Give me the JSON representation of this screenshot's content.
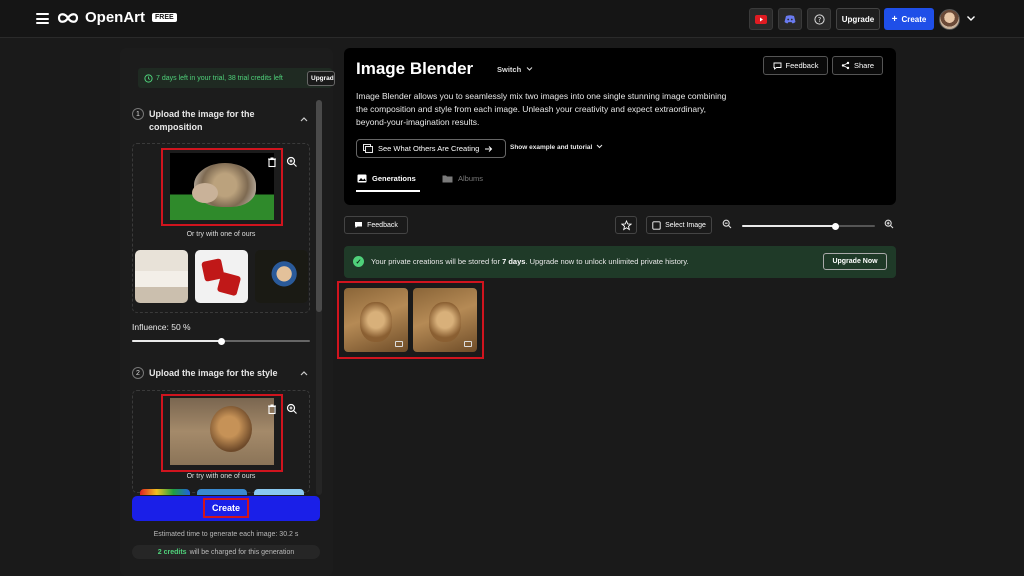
{
  "topbar": {
    "logo_text": "OpenArt",
    "badge": "FREE",
    "upgrade_label": "Upgrade",
    "create_label": "Create",
    "create_icon": "+"
  },
  "left": {
    "trial_text": "7 days left in your trial, 38 trial credits left",
    "trial_upgrade": "Upgrade",
    "step1": {
      "num": "1",
      "title_line1": "Upload the image for the",
      "title_line2": "composition"
    },
    "or_try": "Or try with one of ours",
    "influence": "Influence: 50 %",
    "influence_value": 50,
    "step2": {
      "num": "2",
      "title": "Upload the image for the style"
    },
    "or_try2": "Or try with one of ours",
    "create_label": "Create",
    "estimate": "Estimated time to generate each image: 30.2 s",
    "credits_bold": "2 credits",
    "credits_rest": "will be charged for this generation"
  },
  "hero": {
    "title": "Image Blender",
    "switch": "Switch",
    "feedback": "Feedback",
    "share": "Share",
    "description": "Image Blender allows you to seamlessly mix two images into one single stunning image combining the composition and style from each image. Unleash your creativity and expect extraordinary, beyond-your-imagination results.",
    "see_others": "See What Others Are Creating",
    "show_example": "Show example and tutorial",
    "tab_generations": "Generations",
    "tab_albums": "Albums"
  },
  "toolbar": {
    "feedback": "Feedback",
    "select_image": "Select Image",
    "zoom_level": 0.7
  },
  "notice": {
    "text_before": "Your private creations will be stored for",
    "days": "7 days",
    "text_after": ". Upgrade now to unlock unlimited private history.",
    "upgrade_now": "Upgrade Now"
  },
  "colors": {
    "accent": "#1f4fe8",
    "highlight": "#d0141e",
    "success": "#4fd17a"
  }
}
